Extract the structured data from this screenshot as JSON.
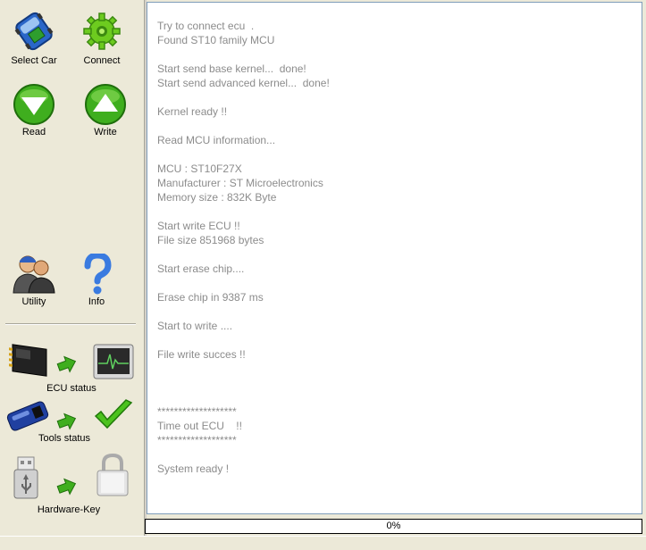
{
  "sidebar": {
    "tools": {
      "select_car": "Select Car",
      "connect": "Connect",
      "read": "Read",
      "write": "Write",
      "utility": "Utility",
      "info": "Info"
    },
    "status": {
      "ecu": "ECU status",
      "tools": "Tools status",
      "hardware_key": "Hardware-Key"
    },
    "icons": {
      "select_car": "car-chip-icon",
      "connect": "gear-icon",
      "read": "arrow-down-icon",
      "write": "arrow-up-icon",
      "utility": "users-icon",
      "info": "question-icon",
      "ecu_chip": "ecu-chip-icon",
      "ecu_monitor": "monitor-icon",
      "tools_device": "interface-device-icon",
      "tools_ok": "checkmark-icon",
      "hw_usb": "usb-key-icon",
      "hw_lock": "padlock-icon"
    },
    "colors": {
      "green": "#4CAF1A",
      "green_dark": "#2E7D0C"
    }
  },
  "log": {
    "lines": [
      "Try to connect ecu  .",
      "Found ST10 family MCU",
      "",
      "Start send base kernel...  done!",
      "Start send advanced kernel...  done!",
      "",
      "Kernel ready !!",
      "",
      "Read MCU information...",
      "",
      "MCU : ST10F27X",
      "Manufacturer : ST Microelectronics",
      "Memory size : 832K Byte",
      "",
      "Start write ECU !!",
      "File size 851968 bytes",
      "",
      "Start erase chip....",
      "",
      "Erase chip in 9387 ms",
      "",
      "Start to write ....",
      "",
      "File write succes !!",
      "",
      "",
      "",
      "*******************",
      "Time out ECU    !!",
      "*******************",
      "",
      "System ready !"
    ]
  },
  "progress": {
    "label": "0%",
    "value": 0
  }
}
